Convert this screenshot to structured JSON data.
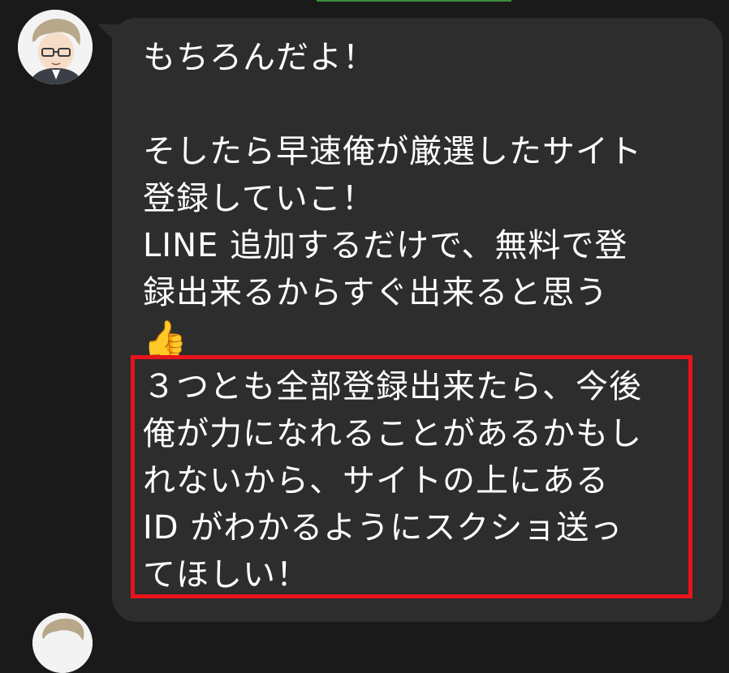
{
  "message": {
    "lines_before": [
      "もちろんだよ！",
      "",
      "そしたら早速俺が厳選したサイト",
      "登録していこ！",
      "LINE 追加するだけで、無料で登",
      "録出来るからすぐ出来ると思う"
    ],
    "emoji": "👍",
    "highlighted_lines": [
      "３つとも全部登録出来たら、今後",
      "俺が力になれることがあるかもし",
      "れないから、サイトの上にある",
      "ID がわかるようにスクショ送っ",
      "てほしい！"
    ]
  },
  "colors": {
    "background": "#1a1a1a",
    "bubble": "#2d2d2d",
    "text": "#ffffff",
    "highlight_border": "#e8141b",
    "top_accent": "#3d8f3d"
  },
  "icons": {
    "avatar": "user-avatar-icon",
    "emoji": "thumbs-up-icon"
  }
}
